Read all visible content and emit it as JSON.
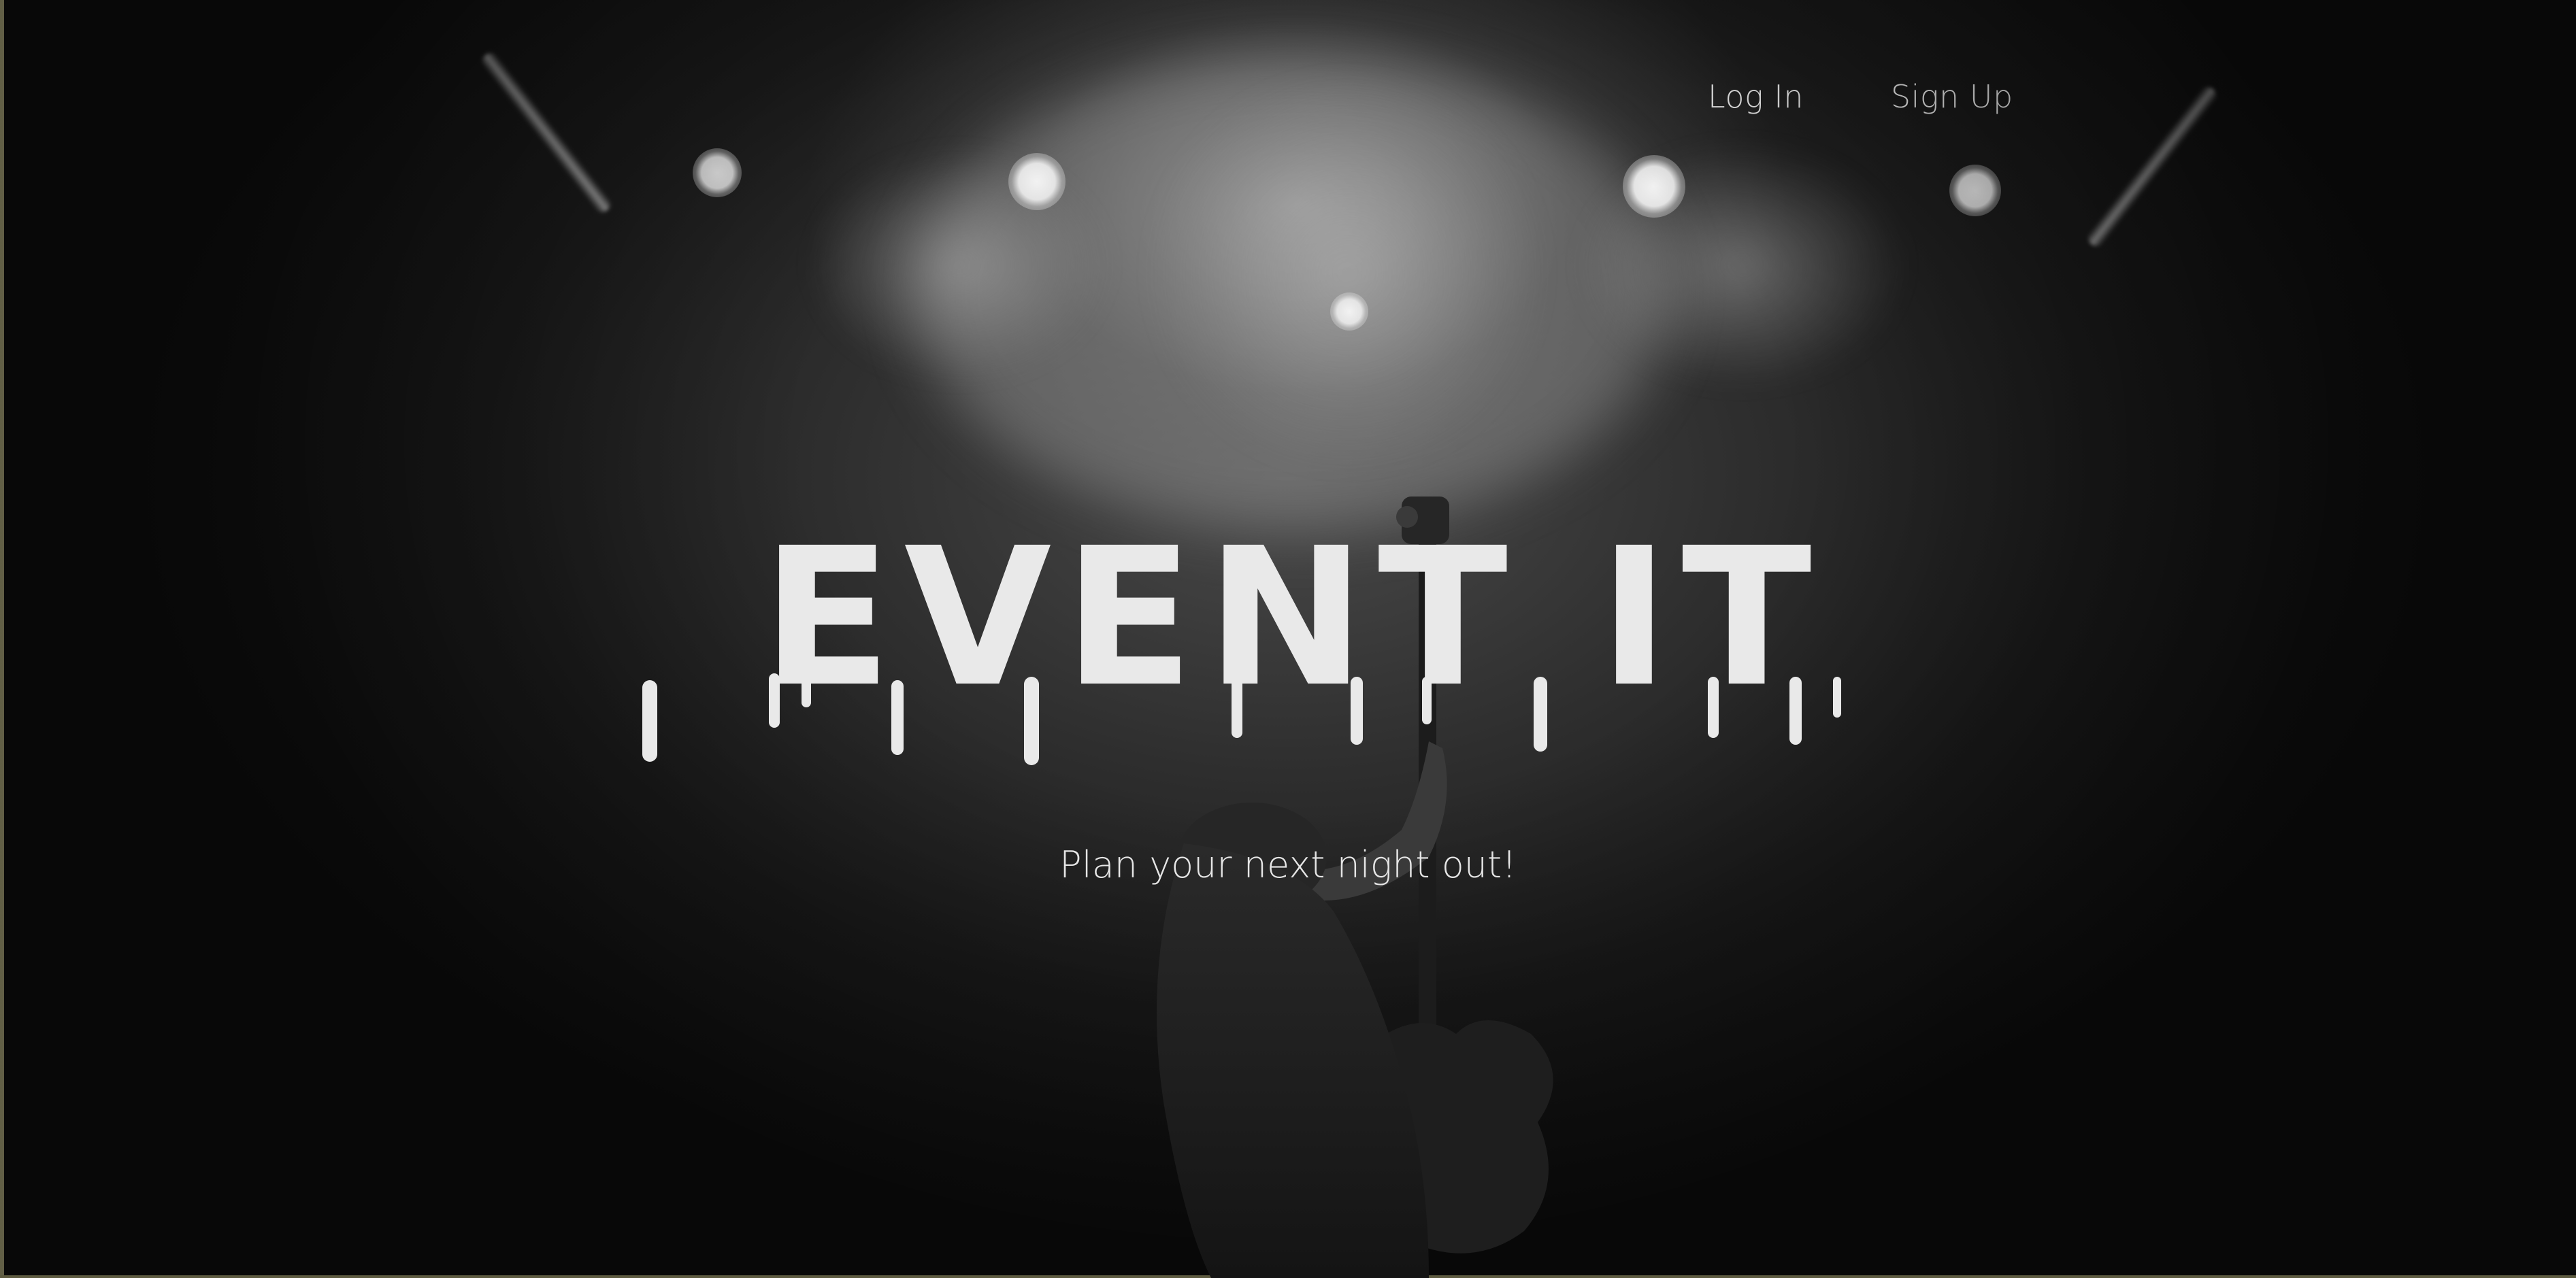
{
  "nav": {
    "login_label": "Log In",
    "signup_label": "Sign Up"
  },
  "hero": {
    "logo_text": "EVENT IT",
    "tagline": "Plan your next night out!"
  },
  "colors": {
    "background": "#111111",
    "text": "#f3f3f3",
    "logo": "#e9e9e9"
  }
}
